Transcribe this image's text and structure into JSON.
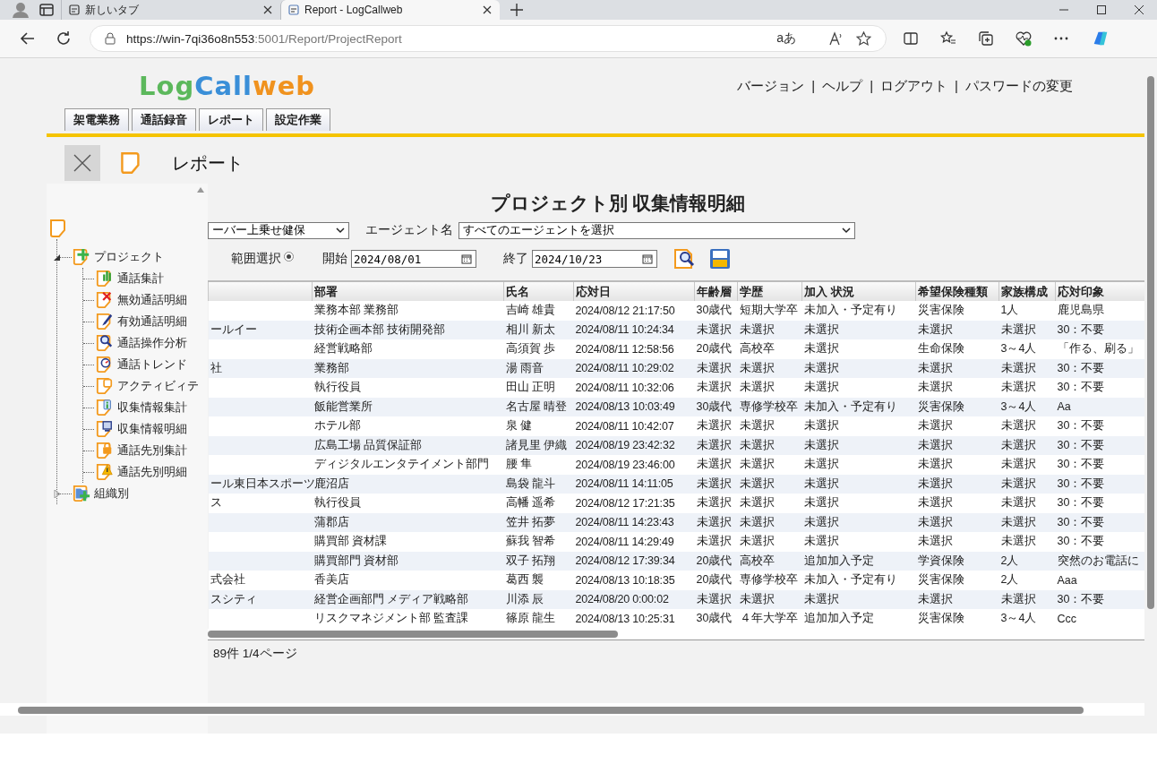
{
  "browser": {
    "tabs": [
      {
        "title": "新しいタブ",
        "selected": false
      },
      {
        "title": "Report - LogCallweb",
        "selected": true
      }
    ],
    "url_host": "https://win-7qi36o8n553",
    "url_path": ":5001/Report/ProjectReport",
    "translate_glyph": "aあ"
  },
  "header": {
    "logo": [
      {
        "text": "Log",
        "color": "#5cb85c"
      },
      {
        "text": "Call",
        "color": "#3a8fd8"
      },
      {
        "text": "web",
        "color": "#f0921e"
      }
    ],
    "links": [
      "バージョン",
      "ヘルプ",
      "ログアウト",
      "パスワードの変更"
    ],
    "separator": "|",
    "nav_tabs": [
      "架電業務",
      "通話録音",
      "レポート",
      "設定作業"
    ]
  },
  "page_title": "レポート",
  "sidebar": {
    "tree": [
      {
        "label": "プロジェクト",
        "kind": "plus",
        "expanded": true,
        "children": [
          {
            "label": "通話集計",
            "kind": "chart"
          },
          {
            "label": "無効通話明細",
            "kind": "cross"
          },
          {
            "label": "有効通話明細",
            "kind": "pen"
          },
          {
            "label": "通話操作分析",
            "kind": "magnifier"
          },
          {
            "label": "通話トレンド",
            "kind": "gauge"
          },
          {
            "label": "アクティビィテ",
            "kind": "note"
          },
          {
            "label": "収集情報集計",
            "kind": "info"
          },
          {
            "label": "収集情報明細",
            "kind": "monitor"
          },
          {
            "label": "通話先別集計",
            "kind": "lock"
          },
          {
            "label": "通話先別明細",
            "kind": "warning"
          }
        ]
      },
      {
        "label": "組織別",
        "kind": "folder",
        "expanded": false
      }
    ]
  },
  "report": {
    "title": "プロジェクト別 収集情報明細",
    "project_select": "ーバー上乗せ健保",
    "agent_label": "エージェント名",
    "agent_select": "すべてのエージェントを選択",
    "range_label": "範囲選択",
    "range_selected": true,
    "start_label": "開始",
    "start": "2024/08/01",
    "end_label": "終了",
    "end": "2024/10/23"
  },
  "table": {
    "columns": [
      "部署",
      "氏名",
      "応対日",
      "年齢層",
      "学歴",
      "加入 状況",
      "希望保険種類",
      "家族構成",
      "応対印象"
    ],
    "rows": [
      {
        "cells": [
          "業務本部 業務部",
          "吉崎 雄貴",
          "2024/08/12 21:17:50",
          "30歳代",
          "短期大学卒",
          "未加入・予定有り",
          "災害保険",
          "1人",
          "鹿児島県"
        ]
      },
      {
        "column_1": "ールイー",
        "cells": [
          "技術企画本部 技術開発部",
          "相川 新太",
          "2024/08/11 10:24:34",
          "未選択",
          "未選択",
          "未選択",
          "未選択",
          "未選択",
          "30：不要"
        ]
      },
      {
        "cells": [
          "経営戦略部",
          "高須賀 歩",
          "2024/08/11 12:58:56",
          "20歳代",
          "高校卒",
          "未選択",
          "生命保険",
          "3～4人",
          "「作る、刷る」"
        ]
      },
      {
        "column_1": "社",
        "cells": [
          "業務部",
          "湯 雨音",
          "2024/08/11 10:29:02",
          "未選択",
          "未選択",
          "未選択",
          "未選択",
          "未選択",
          "30：不要"
        ]
      },
      {
        "cells": [
          "執行役員",
          "田山 正明",
          "2024/08/11 10:32:06",
          "未選択",
          "未選択",
          "未選択",
          "未選択",
          "未選択",
          "30：不要"
        ]
      },
      {
        "cells": [
          "飯能営業所",
          "名古屋 晴登",
          "2024/08/13 10:03:49",
          "30歳代",
          "専修学校卒",
          "未加入・予定有り",
          "災害保険",
          "3～4人",
          "Aa"
        ]
      },
      {
        "cells": [
          "ホテル部",
          "泉 健",
          "2024/08/11 10:42:07",
          "未選択",
          "未選択",
          "未選択",
          "未選択",
          "未選択",
          "30：不要"
        ]
      },
      {
        "cells": [
          "広島工場 品質保証部",
          "諸見里 伊織",
          "2024/08/19 23:42:32",
          "未選択",
          "未選択",
          "未選択",
          "未選択",
          "未選択",
          "30：不要"
        ]
      },
      {
        "cells": [
          "ディジタルエンタテイメント部門",
          "腰 隼",
          "2024/08/19 23:46:00",
          "未選択",
          "未選択",
          "未選択",
          "未選択",
          "未選択",
          "30：不要"
        ]
      },
      {
        "column_1": "ール東日本スポーツ",
        "cells": [
          "鹿沼店",
          "島袋 龍斗",
          "2024/08/11 14:11:05",
          "未選択",
          "未選択",
          "未選択",
          "未選択",
          "未選択",
          "30：不要"
        ]
      },
      {
        "column_1": "ス",
        "cells": [
          "執行役員",
          "高幡 遥希",
          "2024/08/12 17:21:35",
          "未選択",
          "未選択",
          "未選択",
          "未選択",
          "未選択",
          "30：不要"
        ]
      },
      {
        "cells": [
          "蒲郡店",
          "笠井 拓夢",
          "2024/08/11 14:23:43",
          "未選択",
          "未選択",
          "未選択",
          "未選択",
          "未選択",
          "30：不要"
        ]
      },
      {
        "cells": [
          "購買部 資材課",
          "蘇我 智希",
          "2024/08/11 14:29:49",
          "未選択",
          "未選択",
          "未選択",
          "未選択",
          "未選択",
          "30：不要"
        ]
      },
      {
        "cells": [
          "購買部門 資材部",
          "双子 拓翔",
          "2024/08/12 17:39:34",
          "20歳代",
          "高校卒",
          "追加加入予定",
          "学資保険",
          "2人",
          "突然のお電話に"
        ]
      },
      {
        "column_1": "式会社",
        "cells": [
          "香美店",
          "葛西 襲",
          "2024/08/13 10:18:35",
          "20歳代",
          "専修学校卒",
          "未加入・予定有り",
          "災害保険",
          "2人",
          "Aaa"
        ]
      },
      {
        "column_1": "スシティ",
        "cells": [
          "経営企画部門 メディア戦略部",
          "川添 辰",
          "2024/08/20 0:00:02",
          "未選択",
          "未選択",
          "未選択",
          "未選択",
          "未選択",
          "30：不要"
        ]
      },
      {
        "cells": [
          "リスクマネジメント部 監査課",
          "篠原 龍生",
          "2024/08/13 10:25:31",
          "30歳代",
          "４年大学卒",
          "追加加入予定",
          "災害保険",
          "3～4人",
          "Ccc"
        ]
      }
    ]
  },
  "footer": "89件 1/4ページ"
}
